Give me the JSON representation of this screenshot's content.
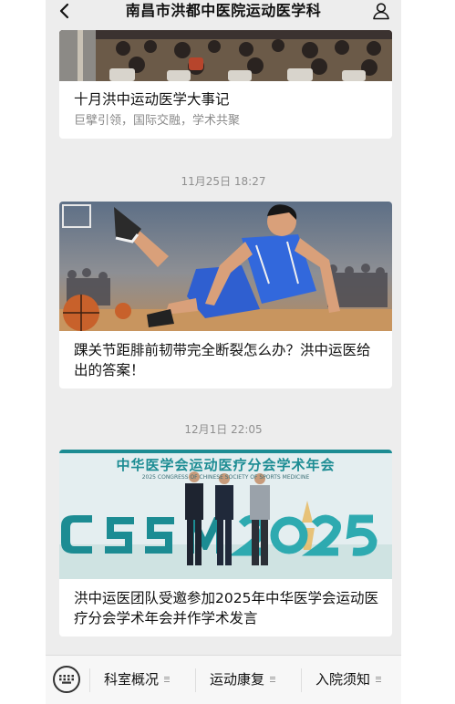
{
  "header": {
    "title": "南昌市洪都中医院运动医学科"
  },
  "feed": [
    {
      "timestamp": "",
      "title": "十月洪中运动医学大事记",
      "subtitle": "巨擘引领，国际交融，学术共聚"
    },
    {
      "timestamp": "11月25日 18:27",
      "title": "踝关节距腓前韧带完全断裂怎么办？洪中运医给出的答案！",
      "subtitle": ""
    },
    {
      "timestamp": "12月1日 22:05",
      "title": "洪中运医团队受邀参加2025年中华医学会运动医疗分会学术年会并作学术发言",
      "subtitle": ""
    }
  ],
  "poster": {
    "headline": "中华医学会运动医疗分会学术年会",
    "subline": "2025 CONGRESS OF CHINESE SOCIETY OF SPORTS MEDICINE",
    "logo_text": "CSSM 2025"
  },
  "bottom_menu": {
    "items": [
      "科室概况",
      "运动康复",
      "入院须知"
    ]
  },
  "colors": {
    "page_background": "#ededed",
    "card_background": "#ffffff",
    "timestamp_text": "#8f8f8f",
    "poster_teal": "#1c8c93",
    "jersey_blue": "#2f5fd0"
  },
  "icons": {
    "back": "chevron-left-icon",
    "profile": "person-icon",
    "keyboard": "keyboard-icon",
    "menu": "menu-lines-icon"
  }
}
